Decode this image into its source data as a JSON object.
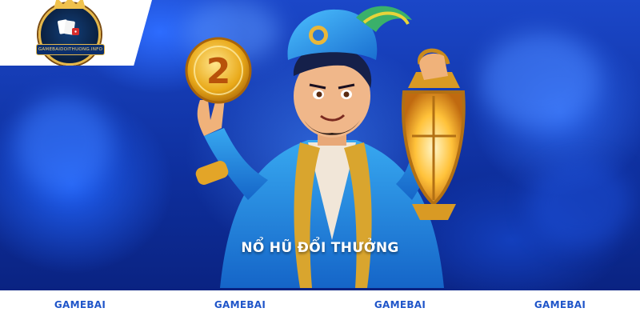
{
  "logo": {
    "text": "GAMEBAIDOITHUONG.INFO"
  },
  "hero": {
    "caption": "NỔ HŨ ĐỔI THƯỞNG",
    "coin_number": "2",
    "colors": {
      "background": "#1b47c8",
      "caption": "#ffffff",
      "gold": "#f0c24d",
      "turban": "#2a8be0"
    }
  },
  "footer": {
    "items": [
      {
        "label": "GAMEBAI"
      },
      {
        "label": "GAMEBAI"
      },
      {
        "label": "GAMEBAI"
      },
      {
        "label": "GAMEBAI"
      }
    ],
    "colors": {
      "background": "#ffffff",
      "link": "#1f55c9"
    }
  }
}
